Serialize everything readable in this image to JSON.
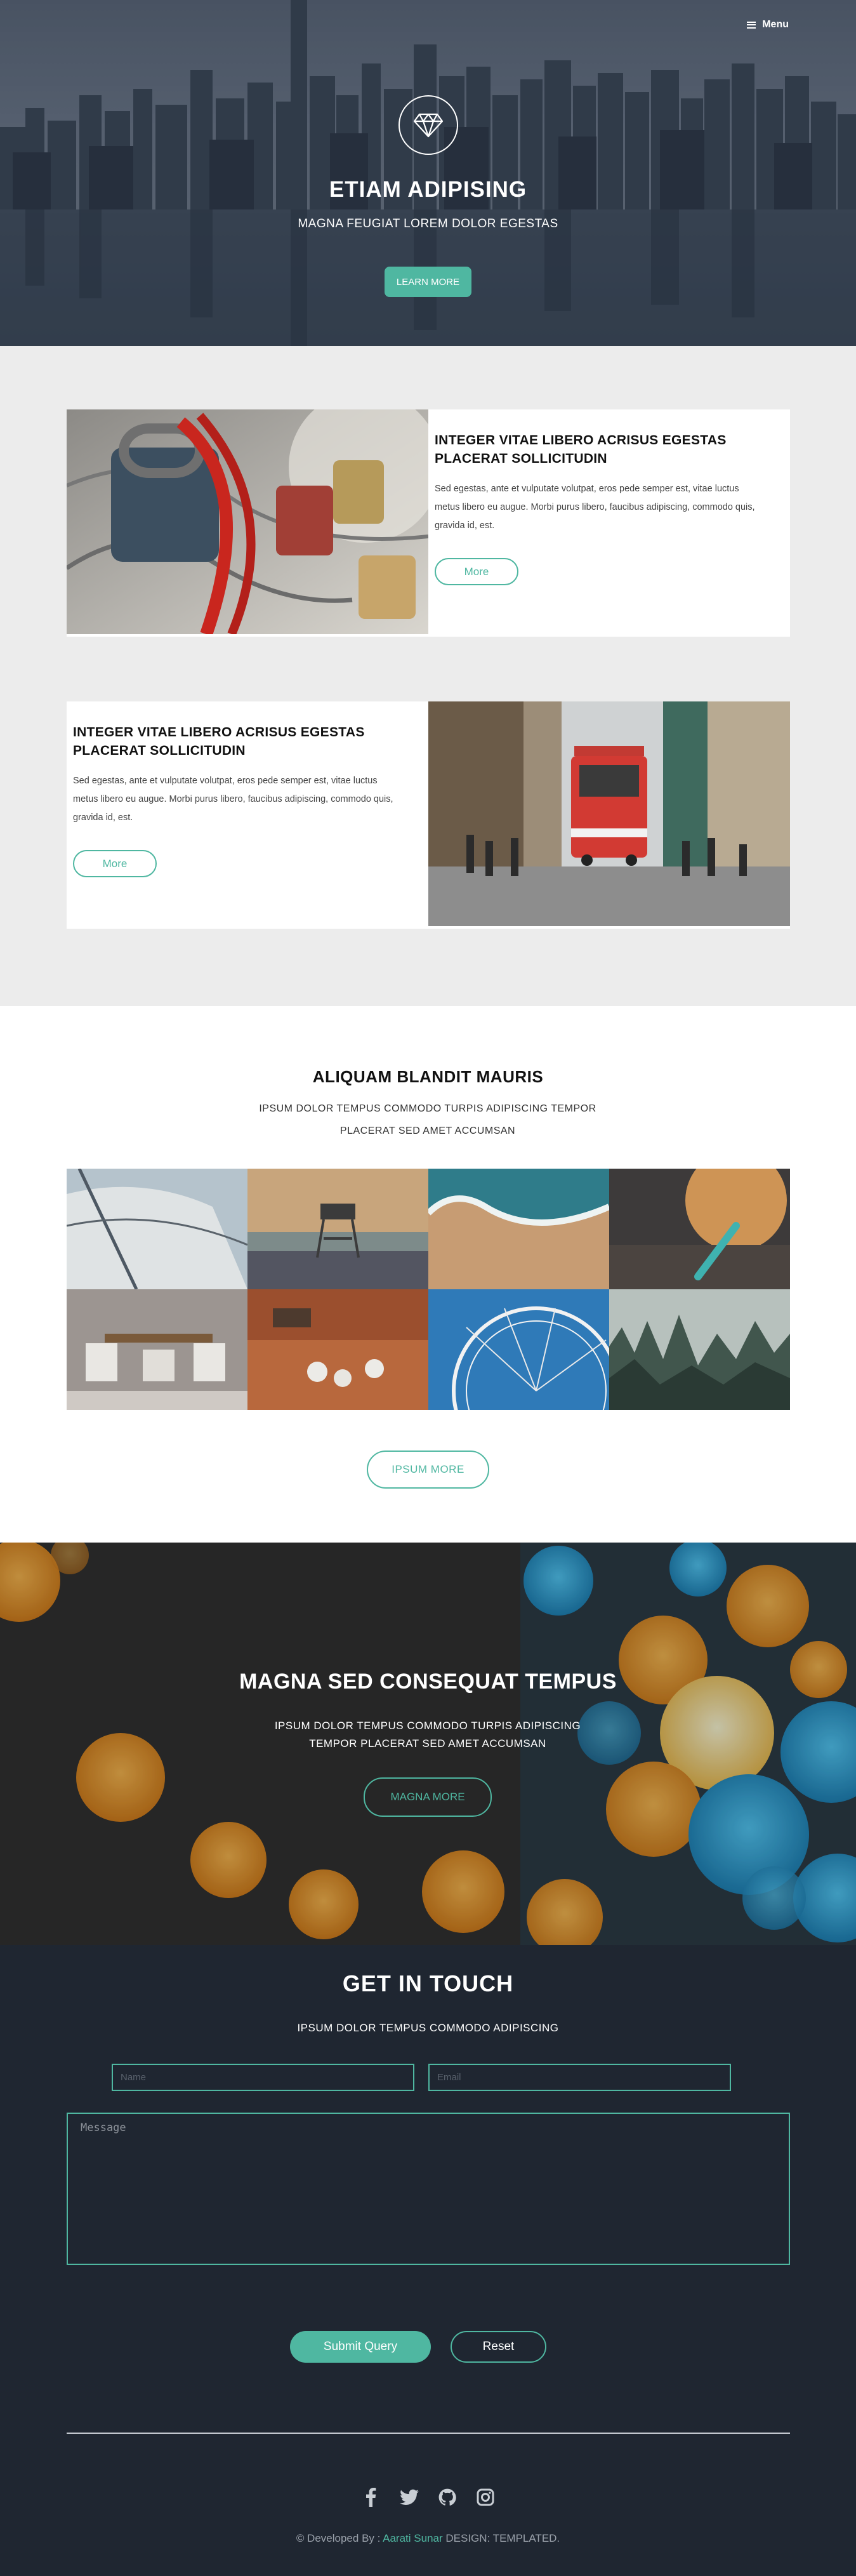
{
  "nav": {
    "menu_label": "Menu",
    "menu_icon": "hamburger-icon"
  },
  "hero": {
    "logo_icon": "diamond-icon",
    "title": "ETIAM ADIPISING",
    "subtitle": "MAGNA FEUGIAT LOREM DOLOR EGESTAS",
    "button": "LEARN MORE"
  },
  "features": [
    {
      "title": "INTEGER VITAE LIBERO ACRISUS EGESTAS PLACERAT SOLLICITUDIN",
      "text": "Sed egestas, ante et vulputate volutpat, eros pede semper est, vitae luctus metus libero eu augue. Morbi purus libero, faucibus adipiscing, commodo quis, gravida id, est.",
      "button": "More"
    },
    {
      "title": "INTEGER VITAE LIBERO ACRISUS EGESTAS PLACERAT SOLLICITUDIN",
      "text": "Sed egestas, ante et vulputate volutpat, eros pede semper est, vitae luctus metus libero eu augue. Morbi purus libero, faucibus adipiscing, commodo quis, gravida id, est.",
      "button": "More"
    }
  ],
  "gallery": {
    "title": "ALIQUAM BLANDIT MAURIS",
    "subtitle": "IPSUM DOLOR TEMPUS COMMODO TURPIS ADIPISCING TEMPOR PLACERAT SED AMET ACCUMSAN",
    "button": "IPSUM MORE"
  },
  "cta": {
    "title": "MAGNA SED CONSEQUAT TEMPUS",
    "subtitle": "IPSUM DOLOR TEMPUS COMMODO TURPIS ADIPISCING TEMPOR PLACERAT SED AMET ACCUMSAN",
    "button": "MAGNA MORE"
  },
  "contact": {
    "title": "GET IN TOUCH",
    "subtitle": "IPSUM DOLOR TEMPUS COMMODO ADIPISCING",
    "name_placeholder": "Name",
    "email_placeholder": "Email",
    "message_placeholder": "Message",
    "submit": "Submit Query",
    "reset": "Reset"
  },
  "footer": {
    "social_icons": [
      "facebook-icon",
      "twitter-icon",
      "github-icon",
      "instagram-icon"
    ],
    "prefix": "© Developed By : ",
    "author": "Aarati Sunar",
    "suffix": " DESIGN: TEMPLATED."
  },
  "colors": {
    "accent": "#4fb7a1",
    "dark_bg": "#1f2631",
    "light_bg": "#ececec"
  }
}
